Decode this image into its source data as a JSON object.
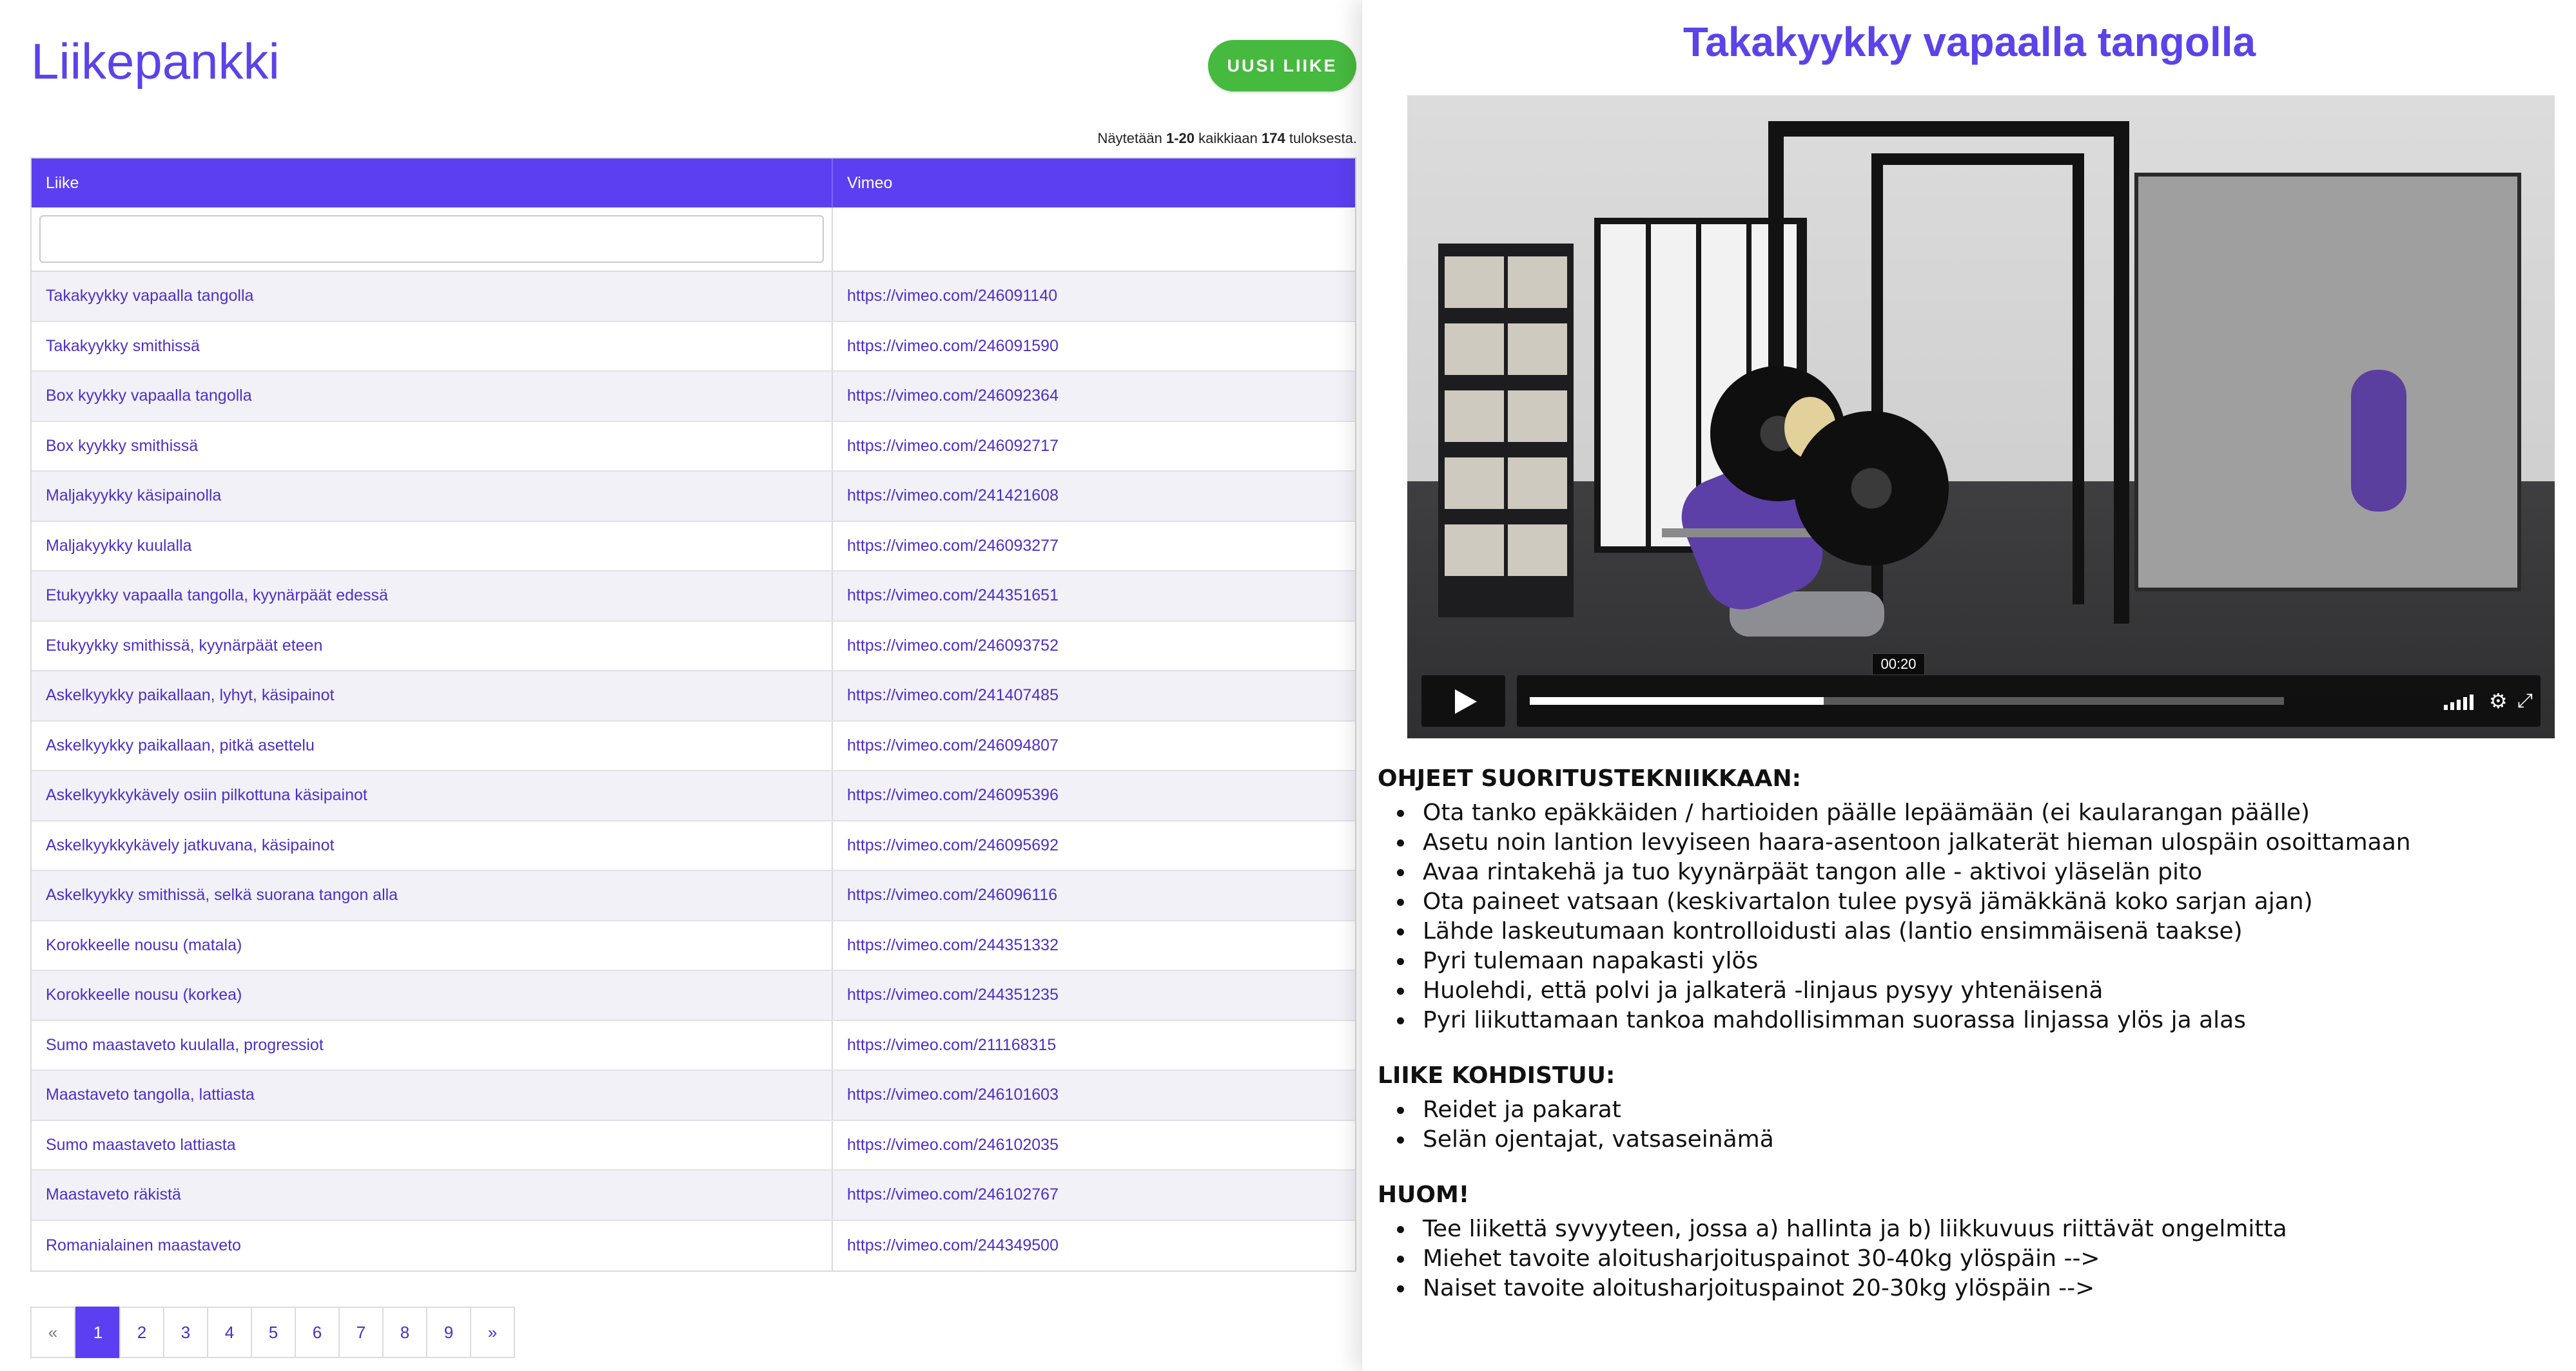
{
  "app": {
    "title": "Liikepankki",
    "new_button": "UUSI LIIKE"
  },
  "results": {
    "prefix": "Näytetään",
    "range": "1-20",
    "middle": "kaikkiaan",
    "total": "174",
    "suffix": "tuloksesta."
  },
  "table": {
    "headers": {
      "name": "Liike",
      "link": "Vimeo"
    },
    "filter_placeholder": "",
    "rows": [
      {
        "name": "Takakyykky vapaalla tangolla",
        "link": "https://vimeo.com/246091140"
      },
      {
        "name": "Takakyykky smithissä",
        "link": "https://vimeo.com/246091590"
      },
      {
        "name": "Box kyykky vapaalla tangolla",
        "link": "https://vimeo.com/246092364"
      },
      {
        "name": "Box kyykky smithissä",
        "link": "https://vimeo.com/246092717"
      },
      {
        "name": "Maljakyykky käsipainolla",
        "link": "https://vimeo.com/241421608"
      },
      {
        "name": "Maljakyykky kuulalla",
        "link": "https://vimeo.com/246093277"
      },
      {
        "name": "Etukyykky vapaalla tangolla, kyynärpäät edessä",
        "link": "https://vimeo.com/244351651"
      },
      {
        "name": "Etukyykky smithissä, kyynärpäät eteen",
        "link": "https://vimeo.com/246093752"
      },
      {
        "name": "Askelkyykky paikallaan, lyhyt, käsipainot",
        "link": "https://vimeo.com/241407485"
      },
      {
        "name": "Askelkyykky paikallaan, pitkä asettelu",
        "link": "https://vimeo.com/246094807"
      },
      {
        "name": "Askelkyykkykävely osiin pilkottuna käsipainot",
        "link": "https://vimeo.com/246095396"
      },
      {
        "name": "Askelkyykkykävely jatkuvana, käsipainot",
        "link": "https://vimeo.com/246095692"
      },
      {
        "name": "Askelkyykky smithissä, selkä suorana tangon alla",
        "link": "https://vimeo.com/246096116"
      },
      {
        "name": "Korokkeelle nousu (matala)",
        "link": "https://vimeo.com/244351332"
      },
      {
        "name": "Korokkeelle nousu (korkea)",
        "link": "https://vimeo.com/244351235"
      },
      {
        "name": "Sumo maastaveto kuulalla, progressiot",
        "link": "https://vimeo.com/211168315"
      },
      {
        "name": "Maastaveto tangolla, lattiasta",
        "link": "https://vimeo.com/246101603"
      },
      {
        "name": "Sumo maastaveto lattiasta",
        "link": "https://vimeo.com/246102035"
      },
      {
        "name": "Maastaveto räkistä",
        "link": "https://vimeo.com/246102767"
      },
      {
        "name": "Romanialainen maastaveto",
        "link": "https://vimeo.com/244349500"
      }
    ]
  },
  "pagination": {
    "prev": "«",
    "next": "»",
    "pages": [
      "1",
      "2",
      "3",
      "4",
      "5",
      "6",
      "7",
      "8",
      "9"
    ],
    "active": "1"
  },
  "detail": {
    "title": "Takakyykky vapaalla tangolla",
    "video": {
      "time_tooltip": "00:20",
      "progress": 0.39,
      "icons": [
        "play-icon",
        "signal-icon",
        "gear-icon",
        "fullscreen-icon"
      ]
    },
    "sections": [
      {
        "heading": "OHJEET SUORITUSTEKNIIKKAAN:",
        "items": [
          "Ota tanko epäkkäiden / hartioiden päälle lepäämään (ei kaularangan päälle)",
          "Asetu noin lantion levyiseen haara-asentoon jalkaterät hieman ulospäin osoittamaan",
          "Avaa rintakehä ja tuo kyynärpäät tangon alle - aktivoi yläselän pito",
          "Ota paineet vatsaan (keskivartalon tulee pysyä jämäkkänä koko sarjan ajan)",
          "Lähde laskeutumaan kontrolloidusti alas (lantio ensimmäisenä taakse)",
          "Pyri tulemaan napakasti ylös",
          "Huolehdi, että polvi ja jalkaterä -linjaus pysyy yhtenäisenä",
          "Pyri liikuttamaan tankoa mahdollisimman suorassa linjassa ylös ja alas"
        ]
      },
      {
        "heading": "LIIKE KOHDISTUU:",
        "items": [
          "Reidet ja pakarat",
          "Selän ojentajat, vatsaseinämä"
        ]
      },
      {
        "heading": "HUOM!",
        "items": [
          "Tee liikettä syvyyteen, jossa a) hallinta ja b) liikkuvuus riittävät ongelmitta",
          "Miehet tavoite aloitusharjoituspainot 30-40kg ylöspäin -->",
          "Naiset tavoite aloitusharjoituspainot 20-30kg ylöspäin -->"
        ]
      }
    ]
  },
  "colors": {
    "accent": "#5b3ff0",
    "title": "#5b43e8",
    "link": "#4e2ec9",
    "button": "#46b93f"
  }
}
